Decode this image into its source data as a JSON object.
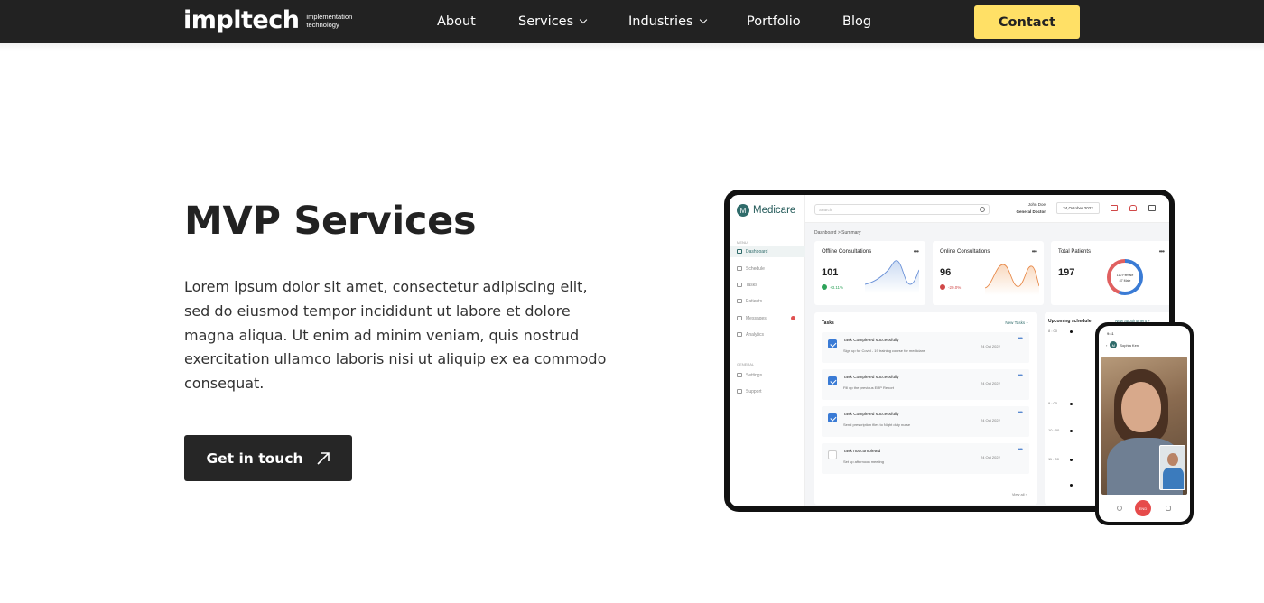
{
  "header": {
    "logo_main": "impltech",
    "logo_sub_line1": "implementation",
    "logo_sub_line2": "technology",
    "nav": [
      {
        "label": "About"
      },
      {
        "label": "Services"
      },
      {
        "label": "Industries"
      },
      {
        "label": "Portfolio"
      },
      {
        "label": "Blog"
      }
    ],
    "contact_label": "Contact",
    "contact_color": "#FFE066"
  },
  "hero": {
    "title": "MVP Services",
    "description": "Lorem ipsum dolor sit amet, consectetur adipiscing elit, sed do eiusmod tempor incididunt ut labore et dolore magna aliqua. Ut enim ad minim veniam, quis nostrud exercitation ullamco laboris nisi ut aliquip ex ea commodo consequat.",
    "cta_label": "Get in touch"
  },
  "mockup": {
    "brand_initial": "M",
    "brand_name": "Medicare",
    "menu_label": "MENU",
    "general_label": "GENERAL",
    "sidebar": [
      "Dashboard",
      "Schedule",
      "Tasks",
      "Patients",
      "Messages",
      "Analytics"
    ],
    "sidebar_general": [
      "Settings",
      "Support"
    ],
    "search_placeholder": "Search",
    "user_name": "John Doe",
    "user_role": "General Doctor",
    "date": "24,October 2022",
    "breadcrumb": "Dashboard > Summary",
    "cards": [
      {
        "title": "Offline Consultations",
        "value": "101",
        "change": "+3.11%"
      },
      {
        "title": "Online Consultations",
        "value": "96",
        "change": "-20.0%"
      },
      {
        "title": "Total Patients",
        "value": "197",
        "donut_line1": "110 Female",
        "donut_line2": "87 Male"
      }
    ],
    "tasks_title": "Tasks",
    "new_tasks": "New Tasks",
    "tasks": [
      {
        "title": "Task Completed successfully",
        "sub": "Sign up for Covid - 19 training course for medicians",
        "date": "24 Oct 2022"
      },
      {
        "title": "Task Completed successfully",
        "sub": "Fill up the previous ERP Report",
        "date": "24 Oct 2022"
      },
      {
        "title": "Task Completed successfully",
        "sub": "Send prescription files to Night duty nurse",
        "date": "24 Oct 2022"
      },
      {
        "title": "Task not completed",
        "sub": "Set up afternoon meeting",
        "date": "24 Oct 2022"
      }
    ],
    "view_all": "View all",
    "schedule_title": "Upcoming schedule",
    "new_appointment": "New appointment",
    "times": [
      "8 : 00",
      "9 : 00",
      "10 : 00",
      "11 : 00"
    ],
    "phone_time": "9:41",
    "phone_contact": "Sophia Ken",
    "call_end": "END"
  }
}
